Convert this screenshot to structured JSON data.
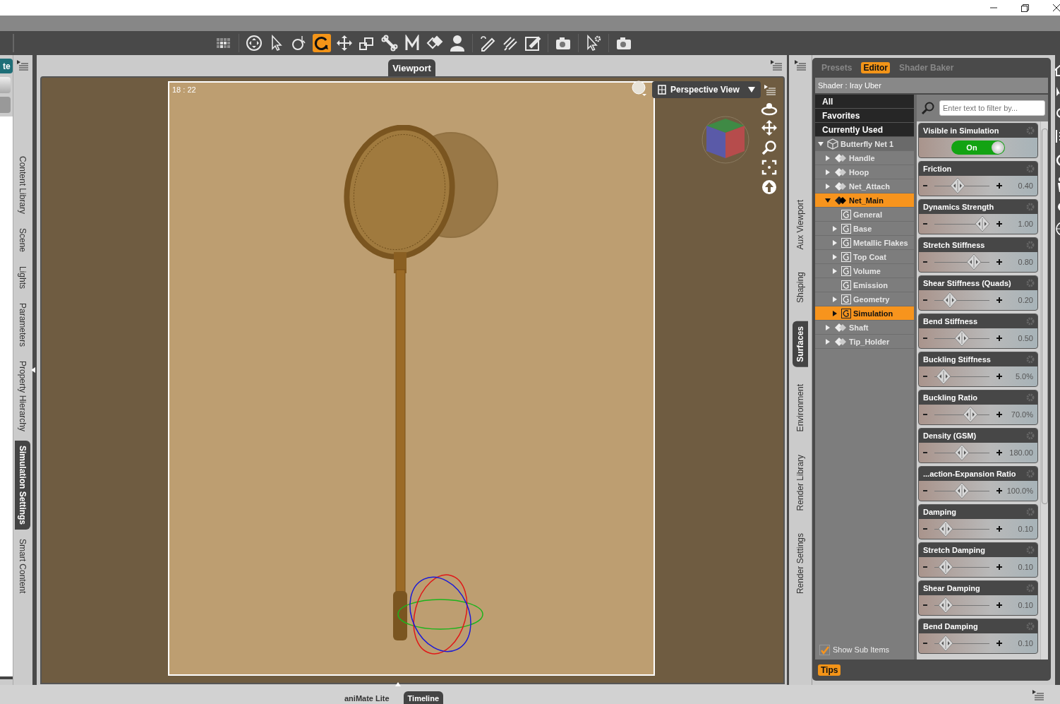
{
  "tool_groups": [
    {
      "tools": [
        {
          "kind": "grid",
          "selected": false
        }
      ]
    },
    {
      "tools": [
        {
          "kind": "move-circle",
          "selected": false
        },
        {
          "kind": "pointer",
          "selected": false
        },
        {
          "kind": "target",
          "selected": false
        },
        {
          "kind": "rotate",
          "selected": true
        },
        {
          "kind": "move-arrows",
          "selected": false
        },
        {
          "kind": "scale",
          "selected": false
        },
        {
          "kind": "bone",
          "selected": false
        },
        {
          "kind": "zigzag",
          "selected": false
        },
        {
          "kind": "diamond",
          "selected": false
        },
        {
          "kind": "person",
          "selected": false
        }
      ]
    },
    {
      "tools": [
        {
          "kind": "pencil",
          "selected": false
        },
        {
          "kind": "brush",
          "selected": false
        },
        {
          "kind": "edit-square",
          "selected": false
        }
      ]
    },
    {
      "tools": [
        {
          "kind": "camera",
          "selected": false
        }
      ]
    },
    {
      "tools": [
        {
          "kind": "pointer-gear",
          "selected": false
        }
      ]
    },
    {
      "tools": [
        {
          "kind": "camera",
          "selected": false
        }
      ]
    }
  ],
  "left_panel": {
    "button": "te",
    "tabs": [
      {
        "label": "Content Library",
        "selected": false
      },
      {
        "label": "Scene",
        "selected": false
      },
      {
        "label": "Lights",
        "selected": false
      },
      {
        "label": "Parameters",
        "selected": false
      },
      {
        "label": "Property Hierarchy",
        "selected": false
      },
      {
        "label": "Simulation Settings",
        "selected": true
      },
      {
        "label": "Smart Content",
        "selected": false
      }
    ]
  },
  "viewport": {
    "tab": "Viewport",
    "frame_label": "18 : 22",
    "view_menu": "Perspective View"
  },
  "right_tabs": [
    {
      "label": "Aux Viewport",
      "selected": false
    },
    {
      "label": "Shaping",
      "selected": false
    },
    {
      "label": "Surfaces",
      "selected": true
    },
    {
      "label": "Environment",
      "selected": false
    },
    {
      "label": "Render Library",
      "selected": false
    },
    {
      "label": "Render Settings",
      "selected": false
    }
  ],
  "surfaces": {
    "tabs": [
      {
        "label": "Presets",
        "selected": false
      },
      {
        "label": "Editor",
        "selected": true
      },
      {
        "label": "Shader Baker",
        "selected": false
      }
    ],
    "shader": "Shader : Iray Uber",
    "filters": [
      "All",
      "Favorites",
      "Currently Used"
    ],
    "tree": [
      {
        "label": "Butterfly Net 1",
        "kind": "figure",
        "expanded": true,
        "selected": false,
        "children": [
          {
            "label": "Handle",
            "kind": "node",
            "expanded": false,
            "selected": false
          },
          {
            "label": "Hoop",
            "kind": "node",
            "expanded": false,
            "selected": false
          },
          {
            "label": "Net_Attach",
            "kind": "node",
            "expanded": false,
            "selected": false
          },
          {
            "label": "Net_Main",
            "kind": "node",
            "expanded": true,
            "selected": true,
            "children": [
              {
                "label": "General",
                "kind": "leaf",
                "expanded": false,
                "selected": false
              },
              {
                "label": "Base",
                "kind": "group",
                "expanded": false,
                "selected": false
              },
              {
                "label": "Metallic Flakes",
                "kind": "group",
                "expanded": false,
                "selected": false
              },
              {
                "label": "Top Coat",
                "kind": "group",
                "expanded": false,
                "selected": false
              },
              {
                "label": "Volume",
                "kind": "group",
                "expanded": false,
                "selected": false
              },
              {
                "label": "Emission",
                "kind": "leaf",
                "expanded": false,
                "selected": false
              },
              {
                "label": "Geometry",
                "kind": "group",
                "expanded": false,
                "selected": false
              },
              {
                "label": "Simulation",
                "kind": "group",
                "expanded": false,
                "selected": true
              }
            ]
          },
          {
            "label": "Shaft",
            "kind": "node",
            "expanded": false,
            "selected": false
          },
          {
            "label": "Tip_Holder",
            "kind": "node",
            "expanded": false,
            "selected": false
          }
        ]
      }
    ],
    "show_sub_items": {
      "label": "Show Sub Items",
      "checked": true
    },
    "search": {
      "placeholder": "Enter text to filter by..."
    },
    "properties": [
      {
        "kind": "toggle",
        "name": "Visible in Simulation",
        "on": true,
        "value": "On"
      },
      {
        "kind": "slider",
        "name": "Friction",
        "level": 0.4,
        "reading": "0.40"
      },
      {
        "kind": "slider",
        "name": "Dynamics Strength",
        "level": 1.0,
        "reading": "1.00"
      },
      {
        "kind": "slider",
        "name": "Stretch Stiffness",
        "level": 0.8,
        "reading": "0.80"
      },
      {
        "kind": "slider",
        "name": "Shear Stiffness (Quads)",
        "level": 0.2,
        "reading": "0.20"
      },
      {
        "kind": "slider",
        "name": "Bend Stiffness",
        "level": 0.5,
        "reading": "0.50"
      },
      {
        "kind": "slider",
        "name": "Buckling Stiffness",
        "level": 0.05,
        "reading": "5.0%"
      },
      {
        "kind": "slider",
        "name": "Buckling Ratio",
        "level": 0.7,
        "reading": "70.0%"
      },
      {
        "kind": "slider",
        "name": "Density (GSM)",
        "level": 0.5,
        "reading": "180.00"
      },
      {
        "kind": "slider",
        "name": "...action-Expansion Ratio",
        "level": 0.5,
        "reading": "100.0%"
      },
      {
        "kind": "slider",
        "name": "Damping",
        "level": 0.1,
        "reading": "0.10"
      },
      {
        "kind": "slider",
        "name": "Stretch Damping",
        "level": 0.1,
        "reading": "0.10"
      },
      {
        "kind": "slider",
        "name": "Shear Damping",
        "level": 0.1,
        "reading": "0.10"
      },
      {
        "kind": "slider",
        "name": "Bend Damping",
        "level": 0.1,
        "reading": "0.10"
      }
    ],
    "tips": "Tips"
  },
  "bottom_tabs": [
    {
      "label": "aniMate Lite",
      "selected": false
    },
    {
      "label": "Timeline",
      "selected": true
    }
  ]
}
